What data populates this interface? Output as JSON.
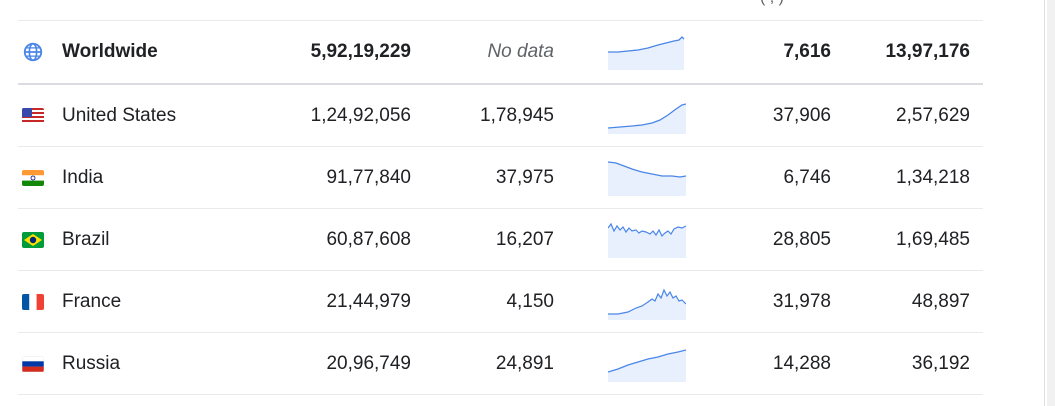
{
  "header_fragment": "( , )",
  "colors": {
    "spark_line": "#4a86e8",
    "spark_fill": "#e8f0fe",
    "globe": "#4a86e8"
  },
  "rows": [
    {
      "name": "Worldwide",
      "icon": "globe-icon",
      "cases": "5,92,19,229",
      "new": "No data",
      "col4": "7,616",
      "col5": "13,97,176"
    },
    {
      "name": "United States",
      "icon": "us-flag-icon",
      "cases": "1,24,92,056",
      "new": "1,78,945",
      "col4": "37,906",
      "col5": "2,57,629"
    },
    {
      "name": "India",
      "icon": "india-flag-icon",
      "cases": "91,77,840",
      "new": "37,975",
      "col4": "6,746",
      "col5": "1,34,218"
    },
    {
      "name": "Brazil",
      "icon": "brazil-flag-icon",
      "cases": "60,87,608",
      "new": "16,207",
      "col4": "28,805",
      "col5": "1,69,485"
    },
    {
      "name": "France",
      "icon": "france-flag-icon",
      "cases": "21,44,979",
      "new": "4,150",
      "col4": "31,978",
      "col5": "48,897"
    },
    {
      "name": "Russia",
      "icon": "russia-flag-icon",
      "cases": "20,96,749",
      "new": "24,891",
      "col4": "14,288",
      "col5": "36,192"
    }
  ]
}
